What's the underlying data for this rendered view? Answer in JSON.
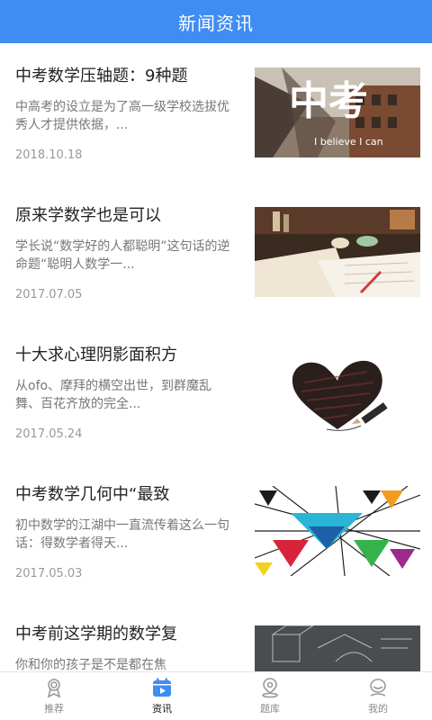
{
  "header": {
    "title": "新闻资讯"
  },
  "articles": [
    {
      "title": "中考数学压轴题：9种题",
      "summary": "中高考的设立是为了高一级学校选拔优秀人才提供依据，...",
      "date": "2018.10.18",
      "image": "chinese-exam-photo",
      "image_text": {
        "big": "中考",
        "small": "I believe I can"
      }
    },
    {
      "title": "原来学数学也是可以",
      "summary": "学长说“数学好的人都聪明”这句话的逆命题“聪明人数学一...",
      "date": "2017.07.05",
      "image": "desk-notebook-photo"
    },
    {
      "title": "十大求心理阴影面积方",
      "summary": "从ofo、摩拜的横空出世，到群魔乱舞、百花齐放的完全...",
      "date": "2017.05.24",
      "image": "pencil-heart-drawing"
    },
    {
      "title": "中考数学几何中“最致",
      "summary": "初中数学的江湖中一直流传着这么一句话：得数学者得天...",
      "date": "2017.05.03",
      "image": "geometric-triangles-art"
    },
    {
      "title": "中考前这学期的数学复",
      "summary": "你和你的孩子是不是都在焦",
      "date": "",
      "image": "chalkboard-geometry-photo"
    }
  ],
  "tabbar": {
    "tabs": [
      {
        "label": "推荐",
        "icon": "award-icon",
        "active": false
      },
      {
        "label": "资讯",
        "icon": "calendar-play-icon",
        "active": true
      },
      {
        "label": "题库",
        "icon": "location-pin-icon",
        "active": false
      },
      {
        "label": "我的",
        "icon": "user-icon",
        "active": false
      }
    ],
    "active_color": "#3f8cf2",
    "inactive_color": "#999999"
  }
}
